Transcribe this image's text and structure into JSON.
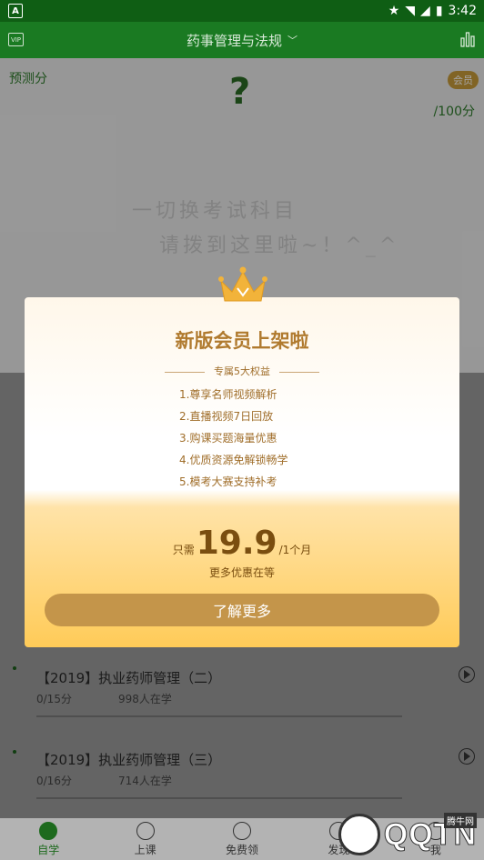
{
  "status_bar": {
    "time": "3:42",
    "app_badge": "A"
  },
  "top_nav": {
    "title": "药事管理与法规",
    "vip_label": "VIP"
  },
  "predict": {
    "label": "预测分",
    "score": "?",
    "badge": "会员",
    "score_suffix": "/100分",
    "line1": "一切换考试科目",
    "line2": "请拨到这里啦~！^_^"
  },
  "list": {
    "rows": [
      {
        "title": "【2019】执业药师管理（二）",
        "score": "0/15分",
        "learners": "998人在学"
      },
      {
        "title": "【2019】执业药师管理（三）",
        "score": "0/16分",
        "learners": "714人在学"
      }
    ]
  },
  "tabs": [
    {
      "label": "自学"
    },
    {
      "label": "上课"
    },
    {
      "label": "免费领"
    },
    {
      "label": "发现"
    },
    {
      "label": "我"
    }
  ],
  "modal": {
    "title": "新版会员上架啦",
    "perks_heading": "专属5大权益",
    "perks": [
      "1.尊享名师视频解析",
      "2.直播视频7日回放",
      "3.购课买题海量优惠",
      "4.优质资源免解锁畅学",
      "5.模考大赛支持补考"
    ],
    "price_prefix": "只需",
    "price": "19.9",
    "price_suffix": "/1个月",
    "more_text": "更多优惠在等",
    "cta": "了解更多"
  },
  "watermark": {
    "brand": "QQTN",
    "small": "腾牛网"
  }
}
